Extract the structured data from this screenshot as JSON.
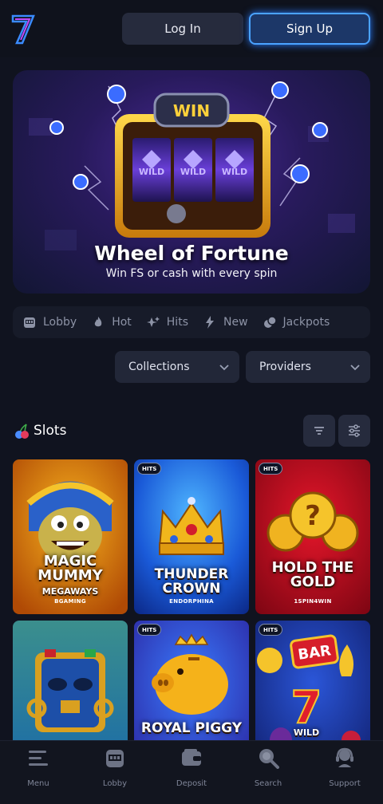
{
  "header": {
    "login_label": "Log In",
    "signup_label": "Sign Up"
  },
  "banner": {
    "title": "Wheel of Fortune",
    "subtitle": "Win FS or cash with every spin",
    "sign_text": "WIN",
    "reel_text": "WILD"
  },
  "categories": [
    {
      "label": "Lobby",
      "icon": "slot-machine-icon"
    },
    {
      "label": "Hot",
      "icon": "flame-icon"
    },
    {
      "label": "Hits",
      "icon": "sparkle-icon"
    },
    {
      "label": "New",
      "icon": "lightning-icon"
    },
    {
      "label": "Jackpots",
      "icon": "coins-icon"
    }
  ],
  "filters": {
    "collections": "Collections",
    "providers": "Providers"
  },
  "section": {
    "title": "Slots"
  },
  "games": [
    {
      "name": "MAGIC\nMUMMY",
      "sub": "MEGAWAYS",
      "provider": "BGAMING",
      "badge": ""
    },
    {
      "name": "THUNDER\nCROWN",
      "sub": "",
      "provider": "ENDORPHINA",
      "badge": "HITS"
    },
    {
      "name": "HOLD THE\nGOLD",
      "sub": "",
      "provider": "1SPIN4WIN",
      "badge": "HITS"
    },
    {
      "name": "",
      "sub": "",
      "provider": "",
      "badge": ""
    },
    {
      "name": "ROYAL PIGGY",
      "sub": "",
      "provider": "",
      "badge": "HITS"
    },
    {
      "name": "WILD",
      "sub": "",
      "provider": "",
      "badge": "HITS",
      "sign": "BAR"
    }
  ],
  "bottom_nav": [
    {
      "label": "Menu",
      "icon": "menu-icon"
    },
    {
      "label": "Lobby",
      "icon": "slot-machine-icon"
    },
    {
      "label": "Deposit",
      "icon": "wallet-icon"
    },
    {
      "label": "Search",
      "icon": "search-icon"
    },
    {
      "label": "Support",
      "icon": "headset-icon"
    }
  ]
}
